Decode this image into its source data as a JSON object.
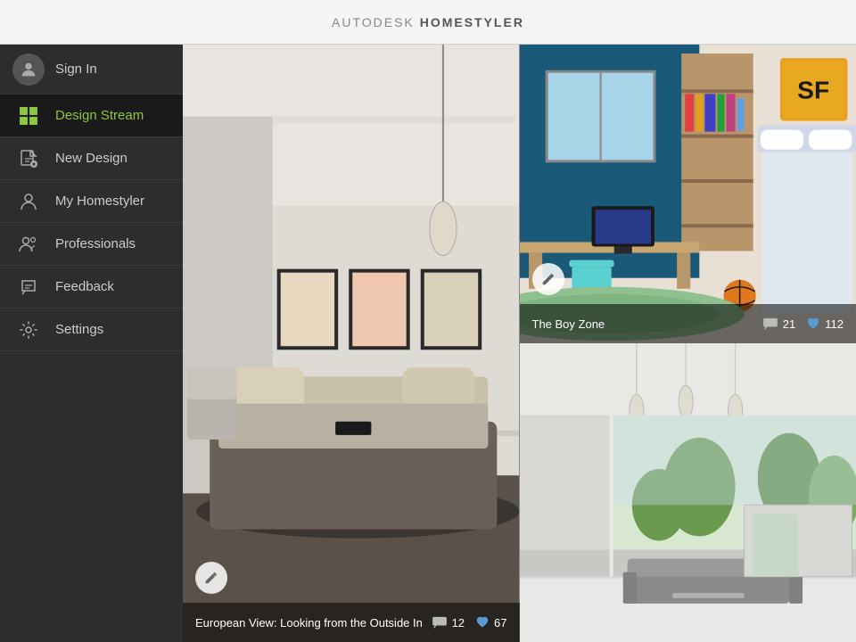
{
  "header": {
    "title_prefix": "AUTODESK",
    "title_suffix": "HOMESTYLER",
    "trademark": "®"
  },
  "sidebar": {
    "signin_label": "Sign In",
    "items": [
      {
        "id": "design-stream",
        "label": "Design Stream",
        "active": true
      },
      {
        "id": "new-design",
        "label": "New Design",
        "active": false
      },
      {
        "id": "my-homestyler",
        "label": "My Homestyler",
        "active": false
      },
      {
        "id": "professionals",
        "label": "Professionals",
        "active": false
      },
      {
        "id": "feedback",
        "label": "Feedback",
        "active": false
      },
      {
        "id": "settings",
        "label": "Settings",
        "active": false
      }
    ]
  },
  "designs": {
    "left_large": {
      "title": "European View: Looking from the Outside In",
      "comments": "12",
      "likes": "67"
    },
    "top_right": {
      "title": "The Boy Zone",
      "comments": "21",
      "likes": "112"
    },
    "bottom_right": {
      "title": "",
      "comments": "",
      "likes": ""
    }
  },
  "icons": {
    "hamburger": "☰",
    "chat_bubble": "💬",
    "heart": "♥",
    "edit": "✏",
    "gear": "⚙",
    "professionals": "★",
    "feedback": "↩",
    "new_design": "📄",
    "my_homestyler": "👤",
    "design_stream_shape": "▦"
  }
}
